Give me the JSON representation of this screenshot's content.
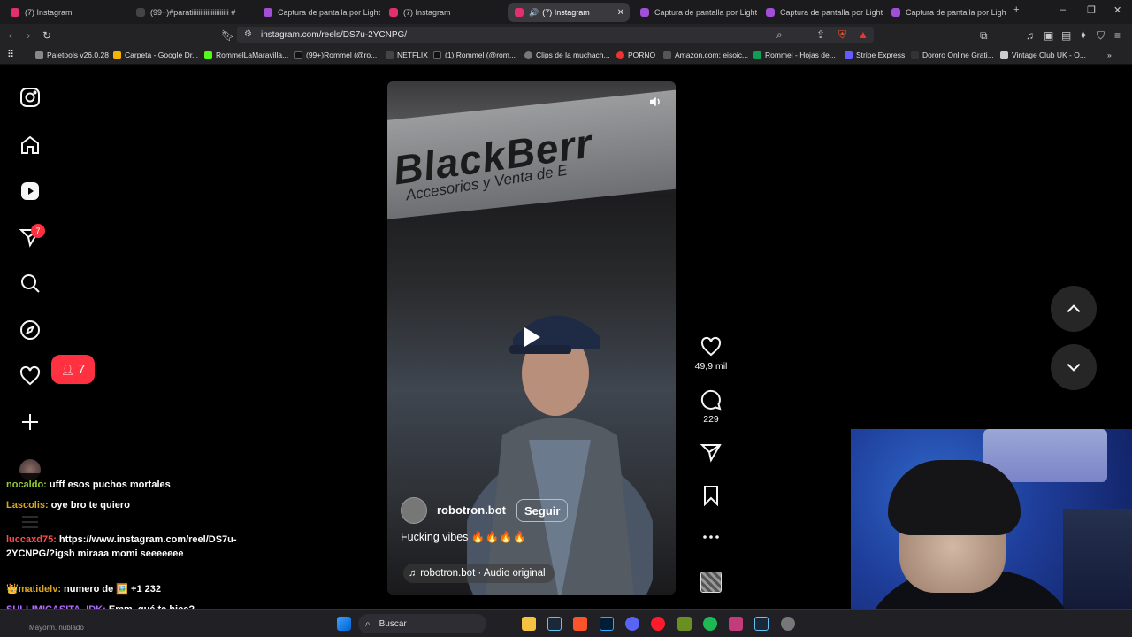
{
  "browser": {
    "tabs": [
      {
        "label": "(7) Instagram",
        "color": "#e1306c"
      },
      {
        "label": "(99+)#paratiiiiiiiiiiiiiiiiiiiii #",
        "color": "#111"
      },
      {
        "label": "Captura de pantalla por Lightshot",
        "color": "#a04fd6"
      },
      {
        "label": "(7) Instagram",
        "color": "#e1306c"
      },
      {
        "label": "(7) Instagram",
        "color": "#e1306c",
        "active": true
      },
      {
        "label": "Captura de pantalla por Lightshot",
        "color": "#a04fd6"
      },
      {
        "label": "Captura de pantalla por Lightshot",
        "color": "#a04fd6"
      },
      {
        "label": "Captura de pantalla por Lightshot",
        "color": "#a04fd6"
      }
    ],
    "url": "instagram.com/reels/DS7u-2YCNPG/",
    "bookmarks": [
      {
        "label": "Paletools v26.0.28",
        "color": "#888"
      },
      {
        "label": "Carpeta - Google Dr...",
        "color": "#f4b400"
      },
      {
        "label": "RommelLaMaravilla...",
        "color": "#53fc18"
      },
      {
        "label": "(99+)Rommel (@ro...",
        "color": "#111"
      },
      {
        "label": "NETFLIX",
        "color": "#444"
      },
      {
        "label": "(1) Rommel (@rom...",
        "color": "#111"
      },
      {
        "label": "Clips de la muchach...",
        "color": "#777"
      },
      {
        "label": "PORNO",
        "color": "#e33"
      },
      {
        "label": "Amazon.com: eisoic...",
        "color": "#555"
      },
      {
        "label": "Rommel - Hojas de...",
        "color": "#0f9d58"
      },
      {
        "label": "Stripe Express",
        "color": "#635bff"
      },
      {
        "label": "Dororo Online Grati...",
        "color": "#333"
      },
      {
        "label": "Vintage Club UK - O...",
        "color": "#ccc"
      }
    ]
  },
  "sidebar": {
    "notifications_badge": "7",
    "activity_count": "7"
  },
  "reel": {
    "sign_text": "BlackBerr",
    "sign_sub": "Accesorios y Venta de E",
    "author": "robotron.bot",
    "follow_label": "Seguir",
    "caption": "Fucking vibes 🔥🔥🔥🔥",
    "audio": "robotron.bot · Audio original",
    "likes": "49,9 mil",
    "comments": "229"
  },
  "chat": [
    {
      "user": "nocaldo:",
      "color": "#9acd32",
      "text": "ufff esos puchos mortales"
    },
    {
      "user": "Lascolis:",
      "color": "#daa520",
      "text": "oye bro te quiero"
    },
    {
      "user": "luccaxd75:",
      "color": "#ff4d4d",
      "text": "https://www.instagram.com/reel/DS7u-2YCNPG/?igsh miraaa momi seeeeeee"
    },
    {
      "user": "👑matidelv:",
      "color": "#daa520",
      "text": "numero de 🖼️ +1 232"
    },
    {
      "user": "SULLIMICASITA_IDK:",
      "color": "#b36bff",
      "text": "Emm, qué te hice?"
    }
  ],
  "taskbar": {
    "search_label": "Buscar",
    "weather": "Mayorm. nublado"
  },
  "colors": {
    "instagram_red": "#ff3040",
    "page_bg": "#000000"
  }
}
